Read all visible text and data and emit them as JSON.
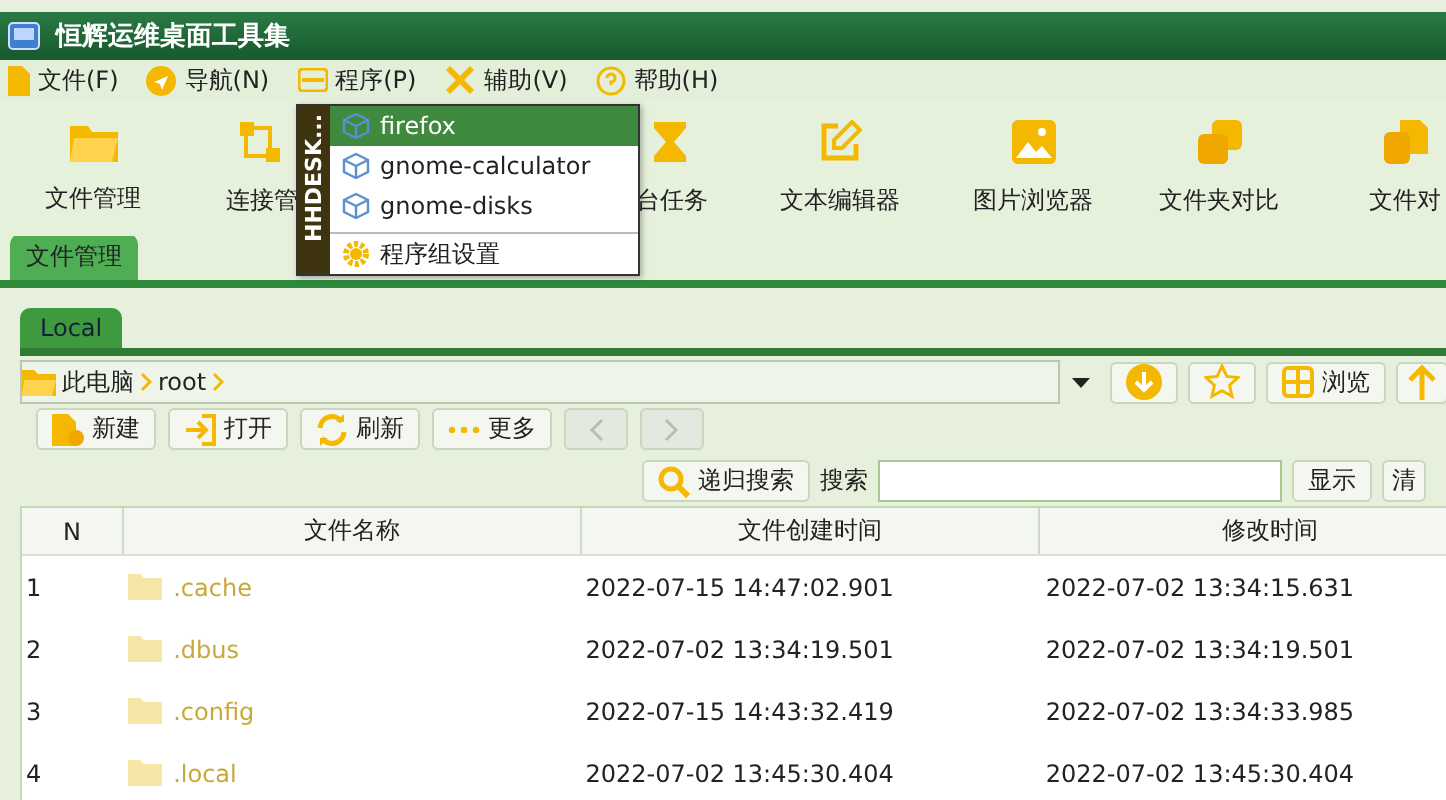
{
  "window": {
    "title": "恒辉运维桌面工具集"
  },
  "menu": [
    {
      "label": "文件(F)",
      "kind": "file"
    },
    {
      "label": "导航(N)",
      "kind": "nav"
    },
    {
      "label": "程序(P)",
      "kind": "program"
    },
    {
      "label": "辅助(V)",
      "kind": "tools"
    },
    {
      "label": "帮助(H)",
      "kind": "help"
    }
  ],
  "toolbar_left": [
    {
      "label": "文件管理",
      "kind": "folder"
    },
    {
      "label": "连接管",
      "kind": "connect"
    }
  ],
  "toolbar_right": [
    {
      "label": "台任务",
      "kind": "hourglass"
    },
    {
      "label": "文本编辑器",
      "kind": "edit"
    },
    {
      "label": "图片浏览器",
      "kind": "image"
    },
    {
      "label": "文件夹对比",
      "kind": "copy"
    },
    {
      "label": "文件对",
      "kind": "files"
    }
  ],
  "main_tabs": [
    {
      "label": "文件管理",
      "selected": true
    }
  ],
  "popup": {
    "side_label": "HHDESK...",
    "items": [
      {
        "label": "firefox",
        "kind": "app",
        "selected": true
      },
      {
        "label": "gnome-calculator",
        "kind": "app",
        "selected": false
      },
      {
        "label": "gnome-disks",
        "kind": "app",
        "selected": false
      },
      {
        "label": "程序组设置",
        "kind": "settings",
        "selected": false
      }
    ]
  },
  "location_tabs": [
    {
      "label": "Local",
      "selected": true
    }
  ],
  "path": [
    "此电脑",
    "root"
  ],
  "path_buttons": [
    {
      "kind": "download"
    },
    {
      "kind": "star"
    },
    {
      "kind": "browse",
      "label": "浏览"
    },
    {
      "kind": "up"
    }
  ],
  "actions": [
    {
      "label": "新建",
      "kind": "new",
      "disabled": false
    },
    {
      "label": "打开",
      "kind": "open",
      "disabled": false
    },
    {
      "label": "刷新",
      "kind": "refresh",
      "disabled": false
    },
    {
      "label": "更多",
      "kind": "more",
      "disabled": false
    },
    {
      "kind": "back",
      "disabled": true
    },
    {
      "kind": "forward",
      "disabled": true
    }
  ],
  "search": {
    "recursive_button": "递归搜索",
    "label": "搜索",
    "show_button": "显示",
    "clear_button": "清"
  },
  "table": {
    "columns": [
      "N",
      "文件名称",
      "文件创建时间",
      "修改时间"
    ],
    "rows": [
      {
        "n": "1",
        "name": ".cache",
        "created": "2022-07-15 14:47:02.901",
        "modified": "2022-07-02 13:34:15.631"
      },
      {
        "n": "2",
        "name": ".dbus",
        "created": "2022-07-02 13:34:19.501",
        "modified": "2022-07-02 13:34:19.501"
      },
      {
        "n": "3",
        "name": ".config",
        "created": "2022-07-15 14:43:32.419",
        "modified": "2022-07-02 13:34:33.985"
      },
      {
        "n": "4",
        "name": ".local",
        "created": "2022-07-02 13:45:30.404",
        "modified": "2022-07-02 13:45:30.404"
      }
    ]
  }
}
